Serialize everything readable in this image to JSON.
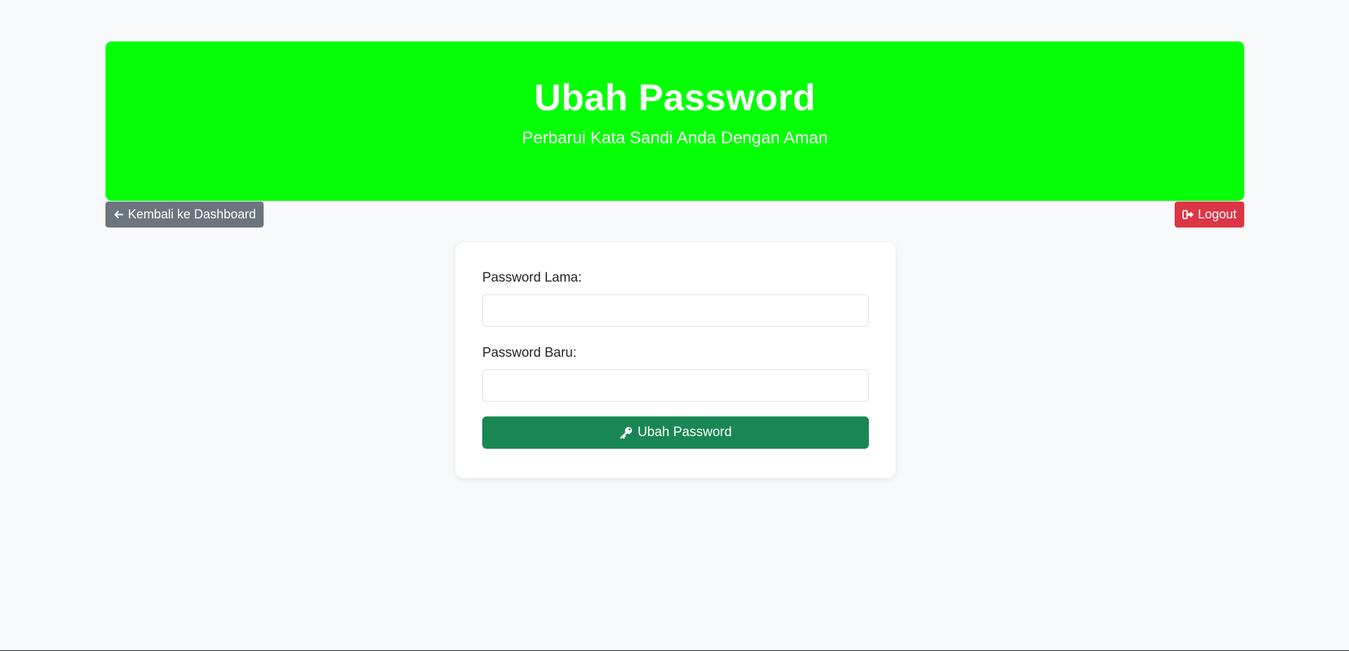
{
  "header": {
    "title": "Ubah Password",
    "subtitle": "Perbarui Kata Sandi Anda Dengan Aman",
    "background_color": "#05ff05"
  },
  "nav": {
    "back_label": "Kembali ke Dashboard",
    "back_icon": "arrow-left-icon",
    "logout_label": "Logout",
    "logout_icon": "sign-out-icon"
  },
  "form": {
    "old_password_label": "Password Lama:",
    "old_password_value": "",
    "new_password_label": "Password Baru:",
    "new_password_value": "",
    "submit_label": "Ubah Password",
    "submit_icon": "key-icon"
  },
  "colors": {
    "back_button": "#6c757d",
    "logout_button": "#dc3545",
    "submit_button": "#198754",
    "page_background": "#f8f9fa"
  }
}
